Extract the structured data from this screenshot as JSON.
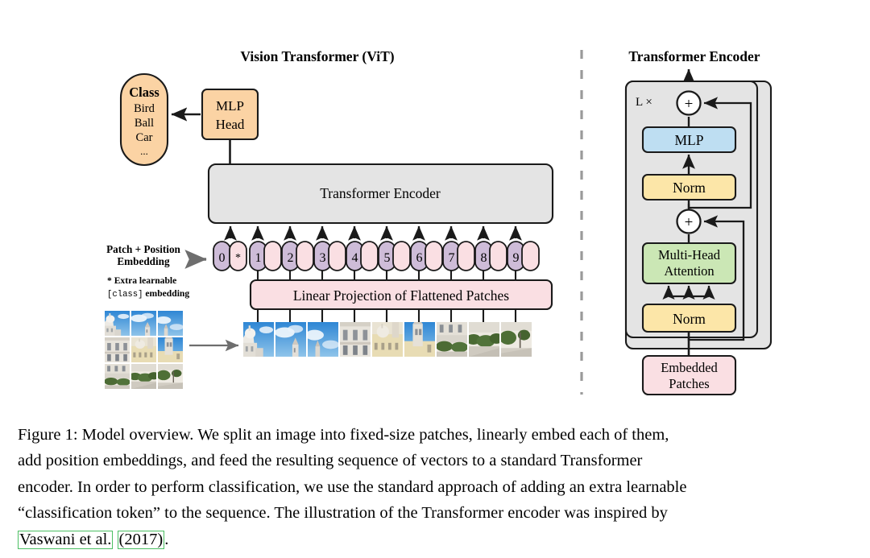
{
  "figure": {
    "left_panel": {
      "title": "Vision Transformer (ViT)",
      "class_head": {
        "title": "Class",
        "items": [
          "Bird",
          "Ball",
          "Car"
        ],
        "ellipsis": "..."
      },
      "mlp_head": {
        "line1": "MLP",
        "line2": "Head"
      },
      "encoder_box": "Transformer Encoder",
      "embedding_label": {
        "line1": "Patch + Position",
        "line2": "Embedding"
      },
      "footnote": {
        "line1": "* Extra learnable",
        "line2_mono": "[class]",
        "line2_rest": " embedding"
      },
      "tokens": [
        "0",
        "1",
        "2",
        "3",
        "4",
        "5",
        "6",
        "7",
        "8",
        "9"
      ],
      "token_star": "*",
      "projection_box": "Linear Projection of Flattened Patches",
      "patch_count": 9,
      "source_grid": {
        "rows": 3,
        "cols": 3
      }
    },
    "right_panel": {
      "title": "Transformer Encoder",
      "repeat_label": "L ×",
      "blocks": {
        "mlp": "MLP",
        "norm_top": "Norm",
        "attention_line1": "Multi-Head",
        "attention_line2": "Attention",
        "norm_bottom": "Norm",
        "embedded_patches_line1": "Embedded",
        "embedded_patches_line2": "Patches"
      },
      "adder_symbol": "+"
    }
  },
  "caption": {
    "line1": "Figure 1: Model overview. We split an image into fixed-size patches, linearly embed each of them,",
    "line2": "add position embeddings, and feed the resulting sequence of vectors to a standard Transformer",
    "line3": "encoder. In order to perform classification, we use the standard approach of adding an extra learnable",
    "line4": "“classification token” to the sequence. The illustration of the Transformer encoder was inspired by",
    "citation_author": "Vaswani et al.",
    "citation_year": "(2017)",
    "citation_tail": "."
  },
  "colors": {
    "peach": "#FBD3A4",
    "grey_box": "#E4E4E4",
    "pink": "#FADFE3",
    "purple_token": "#CEBCD8",
    "blue_mlp": "#BEDEF2",
    "yellow_norm": "#FCE6A8",
    "green_attention": "#CBE7B5",
    "stroke": "#1A1A1A",
    "arrow_grey": "#6E6E6E",
    "divider": "#9A9A9A",
    "citation_border": "#4BBF62"
  }
}
